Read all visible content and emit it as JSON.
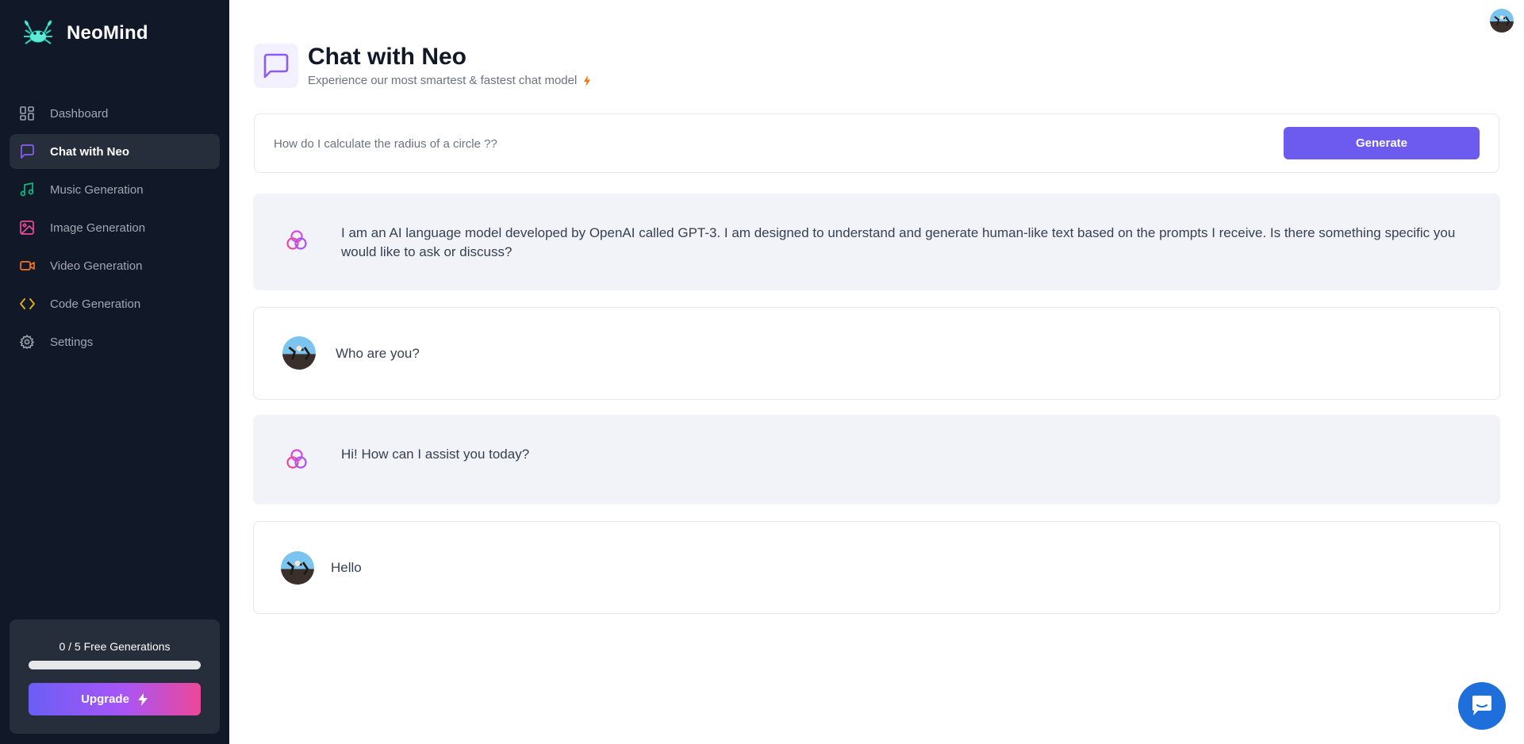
{
  "brand": {
    "name": "NeoMind",
    "logo_icon": "crab-logo-icon"
  },
  "sidebar": {
    "items": [
      {
        "label": "Dashboard",
        "icon": "dashboard-icon",
        "color": "#9ca3af",
        "active": false
      },
      {
        "label": "Chat with Neo",
        "icon": "message-square-icon",
        "color": "#8b5cf6",
        "active": true
      },
      {
        "label": "Music Generation",
        "icon": "music-icon",
        "color": "#10b981",
        "active": false
      },
      {
        "label": "Image Generation",
        "icon": "image-icon",
        "color": "#ec4899",
        "active": false
      },
      {
        "label": "Video Generation",
        "icon": "video-icon",
        "color": "#f97316",
        "active": false
      },
      {
        "label": "Code Generation",
        "icon": "code-icon",
        "color": "#eab308",
        "active": false
      },
      {
        "label": "Settings",
        "icon": "gear-icon",
        "color": "#9ca3af",
        "active": false
      }
    ],
    "free_generations": {
      "label": "0 / 5 Free Generations",
      "used": 0,
      "limit": 5
    },
    "upgrade_label": "Upgrade"
  },
  "header": {
    "title": "Chat with Neo",
    "subtitle": "Experience our most smartest & fastest chat model",
    "accent": "#8b5cf6"
  },
  "prompt": {
    "placeholder": "How do I calculate the radius of a circle ??",
    "value": "",
    "generate_label": "Generate"
  },
  "messages": [
    {
      "role": "bot",
      "text": "I am an AI language model developed by OpenAI called GPT-3. I am designed to understand and generate human-like text based on the prompts I receive. Is there something specific you would like to ask or discuss?"
    },
    {
      "role": "user",
      "text": "Who are you?"
    },
    {
      "role": "bot",
      "text": "Hi! How can I assist you today?"
    },
    {
      "role": "user",
      "text": "Hello"
    }
  ],
  "colors": {
    "sidebar_bg": "#111827",
    "primary": "#6d5bf0",
    "bot_bubble": "#f1f3f8"
  }
}
